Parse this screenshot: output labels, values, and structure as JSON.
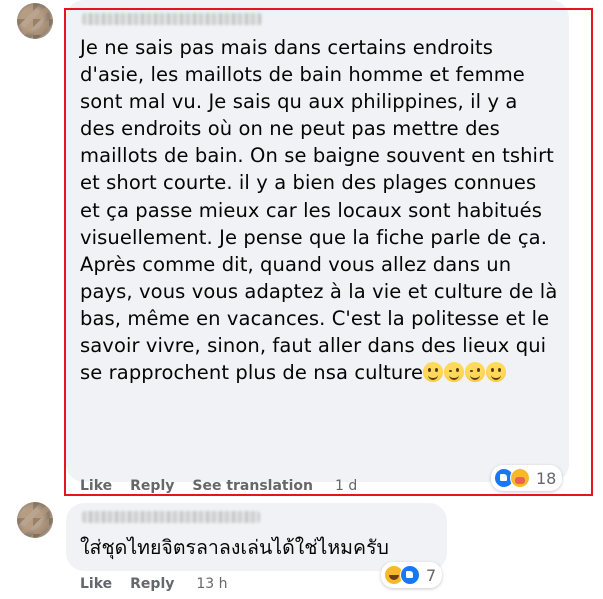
{
  "comments": [
    {
      "text": "Je ne sais pas mais dans certains endroits d'asie, les maillots de bain homme et femme sont mal vu. Je sais qu aux philippines, il y a des endroits où on ne peut pas mettre des maillots de bain. On se baigne souvent en tshirt et short courte. il y a bien des plages connues et ça passe mieux car les locaux sont habitués visuellement. Je pense que la fiche parle de ça. Après comme dit, quand vous allez dans un pays, vous vous adaptez à la vie et culture de là bas, même en vacances. C'est la politesse et le savoir vivre, sinon, faut aller dans des lieux qui se rapprochent plus de nsa culture",
      "reaction_count": "18",
      "reaction_icons": [
        "like-icon",
        "care-icon"
      ],
      "actions": {
        "like": "Like",
        "reply": "Reply",
        "translate": "See translation",
        "time": "1 d"
      }
    },
    {
      "text": "ใส่ชุดไทยจิตรลาลงเล่นได้ใช่ไหมครับ",
      "reaction_count": "7",
      "reaction_icons": [
        "haha-icon",
        "like-icon"
      ],
      "actions": {
        "like": "Like",
        "reply": "Reply",
        "time": "13 h"
      }
    }
  ],
  "highlight_color": "#e3151e",
  "bubble_color": "#f0f2f5",
  "like_color": "#1877f2"
}
